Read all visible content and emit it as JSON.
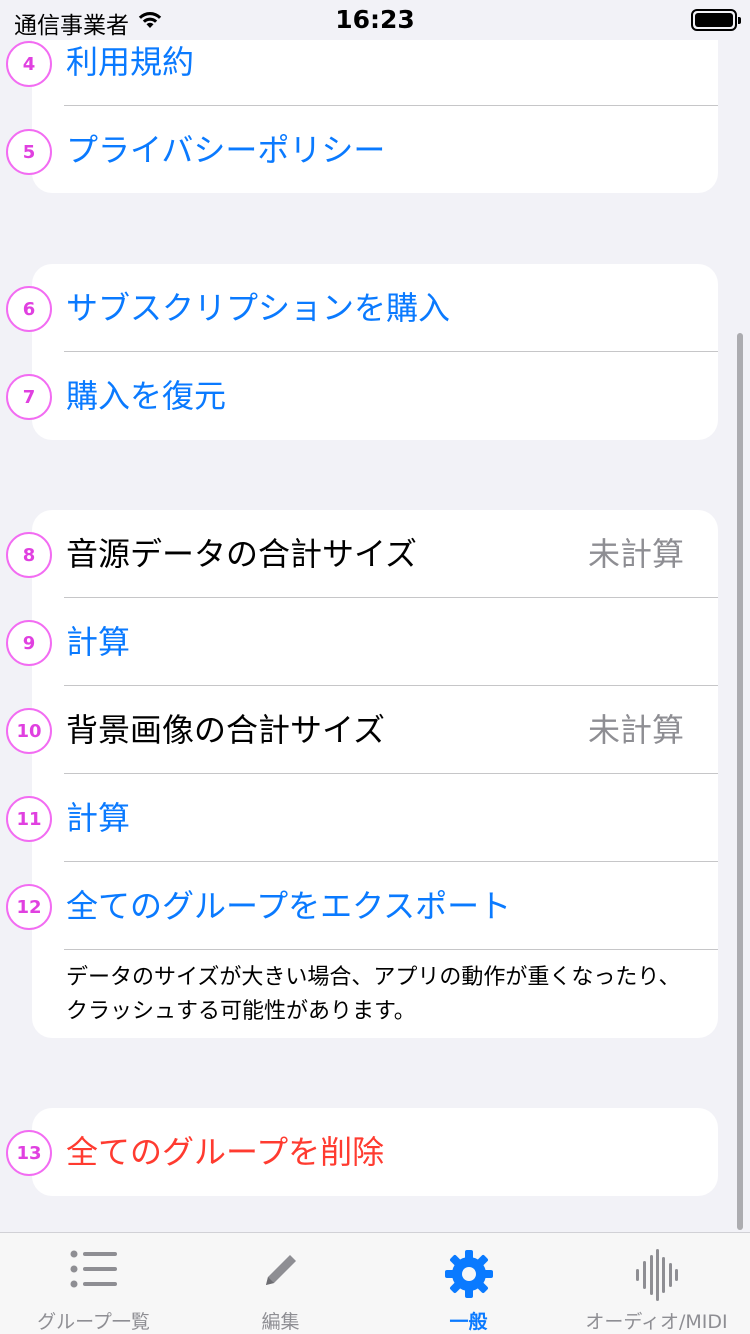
{
  "status_bar": {
    "carrier": "通信事業者",
    "time": "16:23"
  },
  "sections": [
    {
      "rows": [
        {
          "badge": "4",
          "label": "利用規約"
        },
        {
          "badge": "5",
          "label": "プライバシーポリシー"
        }
      ]
    },
    {
      "rows": [
        {
          "badge": "6",
          "label": "サブスクリプションを購入"
        },
        {
          "badge": "7",
          "label": "購入を復元"
        }
      ]
    },
    {
      "rows": [
        {
          "badge": "8",
          "label": "音源データの合計サイズ",
          "value": "未計算"
        },
        {
          "badge": "9",
          "label": "計算"
        },
        {
          "badge": "10",
          "label": "背景画像の合計サイズ",
          "value": "未計算"
        },
        {
          "badge": "11",
          "label": "計算"
        },
        {
          "badge": "12",
          "label": "全てのグループをエクスポート"
        }
      ],
      "footer_line1": "データのサイズが大きい場合、アプリの動作が重くなったり、",
      "footer_line2": "クラッシュする可能性があります。"
    },
    {
      "rows": [
        {
          "badge": "13",
          "label": "全てのグループを削除"
        }
      ]
    }
  ],
  "tab_bar": {
    "tabs": [
      {
        "label": "グループ一覧",
        "icon": "list-icon"
      },
      {
        "label": "編集",
        "icon": "pencil-icon"
      },
      {
        "label": "一般",
        "icon": "gear-icon",
        "active": true
      },
      {
        "label": "オーディオ/MIDI",
        "icon": "waveform-icon"
      }
    ]
  },
  "colors": {
    "link": "#0a7aff",
    "destructive": "#ff3b30",
    "secondary": "#8e8e93",
    "background": "#f2f2f7",
    "badge": "#e040e0"
  }
}
